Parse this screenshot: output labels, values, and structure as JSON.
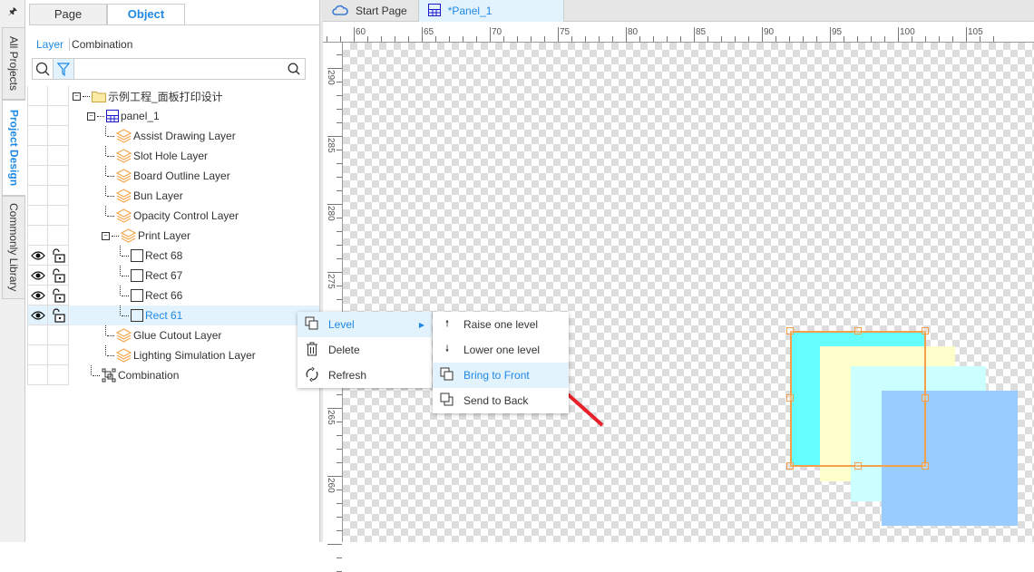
{
  "side_tabs": [
    {
      "label": "All Projects"
    },
    {
      "label": "Project Design"
    },
    {
      "label": "Commonly Library"
    }
  ],
  "panel": {
    "tabs": [
      {
        "label": "Page"
      },
      {
        "label": "Object"
      }
    ],
    "sub_tabs": [
      {
        "label": "Layer"
      },
      {
        "label": "Combination"
      }
    ],
    "search_placeholder": ""
  },
  "tree": [
    {
      "label": "示例工程_面板打印设计",
      "icon": "folder-icon"
    },
    {
      "label": "panel_1",
      "icon": "panel-grid-icon"
    },
    {
      "label": "Assist Drawing Layer",
      "icon": "layers-icon"
    },
    {
      "label": "Slot Hole Layer",
      "icon": "layers-icon"
    },
    {
      "label": "Board Outline Layer",
      "icon": "layers-icon"
    },
    {
      "label": "Bun Layer",
      "icon": "layers-icon"
    },
    {
      "label": "Opacity Control Layer",
      "icon": "layers-icon"
    },
    {
      "label": "Print Layer",
      "icon": "layers-icon"
    },
    {
      "label": "Rect 68",
      "icon": "rect-icon"
    },
    {
      "label": "Rect 67",
      "icon": "rect-icon"
    },
    {
      "label": "Rect 66",
      "icon": "rect-icon"
    },
    {
      "label": "Rect 61",
      "icon": "rect-icon",
      "selected": true
    },
    {
      "label": "Glue Cutout Layer",
      "icon": "layers-icon"
    },
    {
      "label": "Lighting Simulation Layer",
      "icon": "layers-icon"
    },
    {
      "label": "Combination",
      "icon": "combination-icon"
    }
  ],
  "doc_tabs": [
    {
      "label": "Start Page",
      "icon": "cloud-icon"
    },
    {
      "label": "*Panel_1",
      "icon": "panel-grid-icon"
    }
  ],
  "ruler": {
    "h_labels": [
      "60",
      "65",
      "70",
      "75",
      "80",
      "85",
      "90",
      "95",
      "100",
      "105"
    ],
    "v_labels": [
      "290",
      "285",
      "280",
      "275",
      "270",
      "265",
      "260"
    ]
  },
  "context_menu": {
    "items": [
      {
        "label": "Level",
        "icon": "layers-stack-icon"
      },
      {
        "label": "Delete",
        "icon": "trash-icon"
      },
      {
        "label": "Refresh",
        "icon": "refresh-icon"
      }
    ]
  },
  "submenu": {
    "items": [
      {
        "label": "Raise one level",
        "icon": "arrow-up-icon"
      },
      {
        "label": "Lower one level",
        "icon": "arrow-down-icon"
      },
      {
        "label": "Bring to Front",
        "icon": "bring-front-icon"
      },
      {
        "label": "Send to Back",
        "icon": "send-back-icon"
      }
    ]
  },
  "colors": {
    "accent": "#1e88e5",
    "rect61": "#66ffff",
    "rect66": "#ffffcc",
    "rect67": "#ccffff",
    "rect68": "#99ccff",
    "selection": "#f7a04b",
    "arrow": "#e8202a"
  }
}
